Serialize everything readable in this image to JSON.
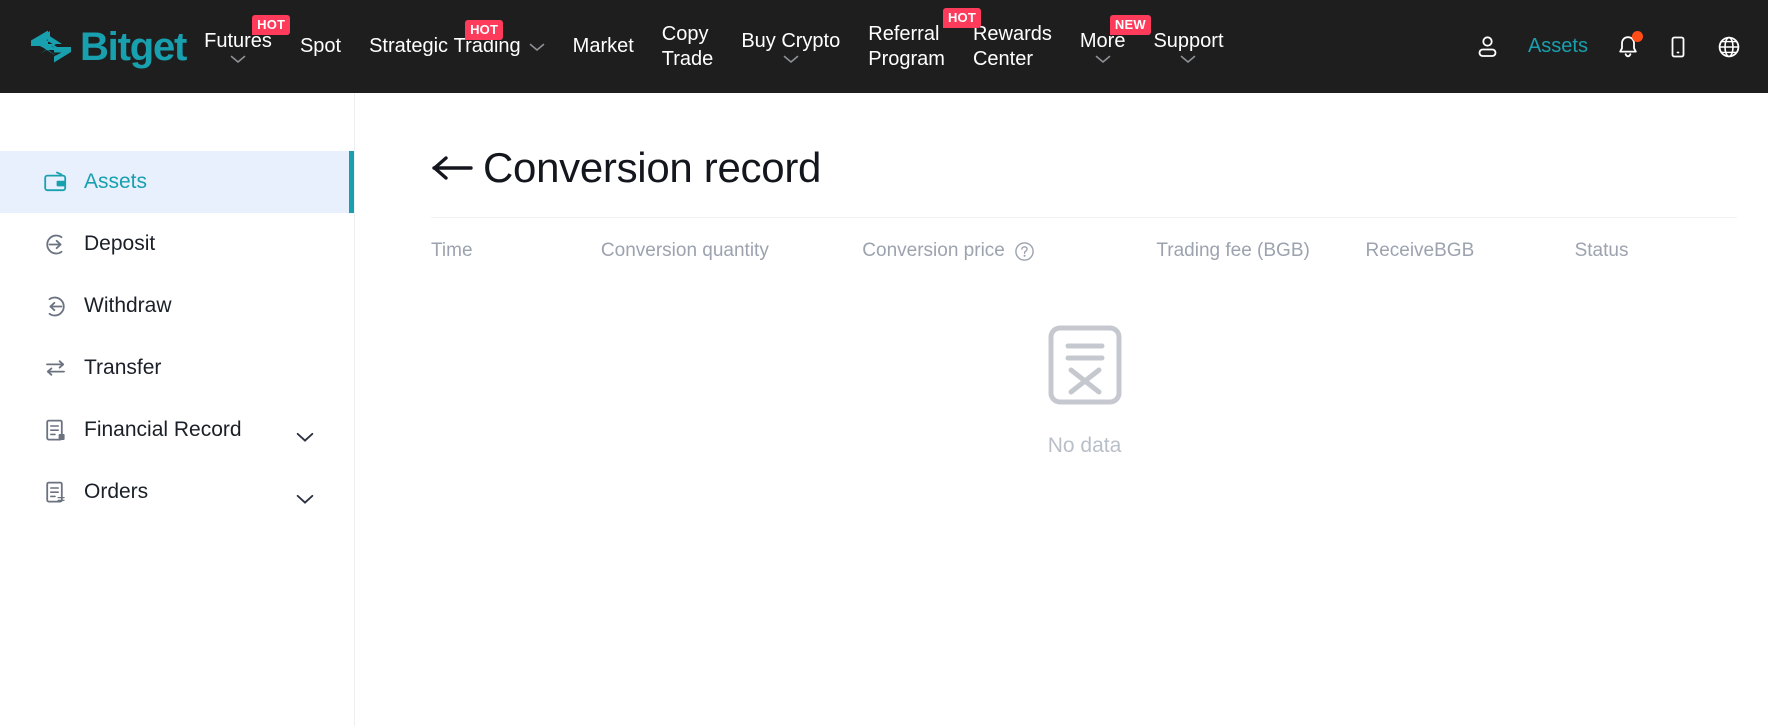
{
  "brand": {
    "name": "Bitget",
    "color": "#18A0AF"
  },
  "topnav": {
    "background": "#1E1E1E",
    "items": [
      {
        "label": "Futures",
        "line2": "",
        "badge": "HOT",
        "chevron": true
      },
      {
        "label": "Spot",
        "line2": "",
        "badge": "",
        "chevron": false
      },
      {
        "label": "Strategic",
        "line2": "Trading",
        "badge": "HOT",
        "chevron": true
      },
      {
        "label": "Market",
        "line2": "",
        "badge": "",
        "chevron": false
      },
      {
        "label": "Copy",
        "line2": "Trade",
        "badge": "",
        "chevron": false
      },
      {
        "label": "Buy Crypto",
        "line2": "",
        "badge": "",
        "chevron": true
      },
      {
        "label": "Referral",
        "line2": "Program",
        "badge": "",
        "chevron": false
      },
      {
        "label": "Rewards",
        "line2": "Center",
        "badge": "HOT",
        "chevron": false
      },
      {
        "label": "More",
        "line2": "",
        "badge": "NEW",
        "chevron": true
      },
      {
        "label": "Support",
        "line2": "",
        "badge": "",
        "chevron": true
      }
    ],
    "badge_colors": {
      "hot": "#FF3B5C",
      "new": "#FF3B5C"
    },
    "assets_label": "Assets",
    "assets_color": "#18A0AF",
    "notification_dot_color": "#FF4D19"
  },
  "sidebar": {
    "items": [
      {
        "label": "Assets",
        "icon": "wallet-icon",
        "active": true,
        "chevron": false
      },
      {
        "label": "Deposit",
        "icon": "deposit-arrow-icon",
        "active": false,
        "chevron": false
      },
      {
        "label": "Withdraw",
        "icon": "withdraw-arrow-icon",
        "active": false,
        "chevron": false
      },
      {
        "label": "Transfer",
        "icon": "transfer-icon",
        "active": false,
        "chevron": false
      },
      {
        "label": "Financial Record",
        "icon": "document-icon",
        "active": false,
        "chevron": true
      },
      {
        "label": "Orders",
        "icon": "orders-document-icon",
        "active": false,
        "chevron": true
      }
    ],
    "active_color": "#18A0AF",
    "active_background": "#E8F0FE"
  },
  "main": {
    "page_title": "Conversion record",
    "back_icon": "back-arrow-icon",
    "table": {
      "columns": [
        {
          "label": "Time",
          "help": false
        },
        {
          "label": "Conversion quantity",
          "help": false
        },
        {
          "label": "Conversion price",
          "help": true
        },
        {
          "label": "Trading fee (BGB)",
          "help": false
        },
        {
          "label": "ReceiveBGB",
          "help": false
        },
        {
          "label": "Status",
          "help": false
        }
      ],
      "rows": []
    },
    "empty_state": {
      "icon": "no-data-document-icon",
      "text": "No data"
    }
  }
}
